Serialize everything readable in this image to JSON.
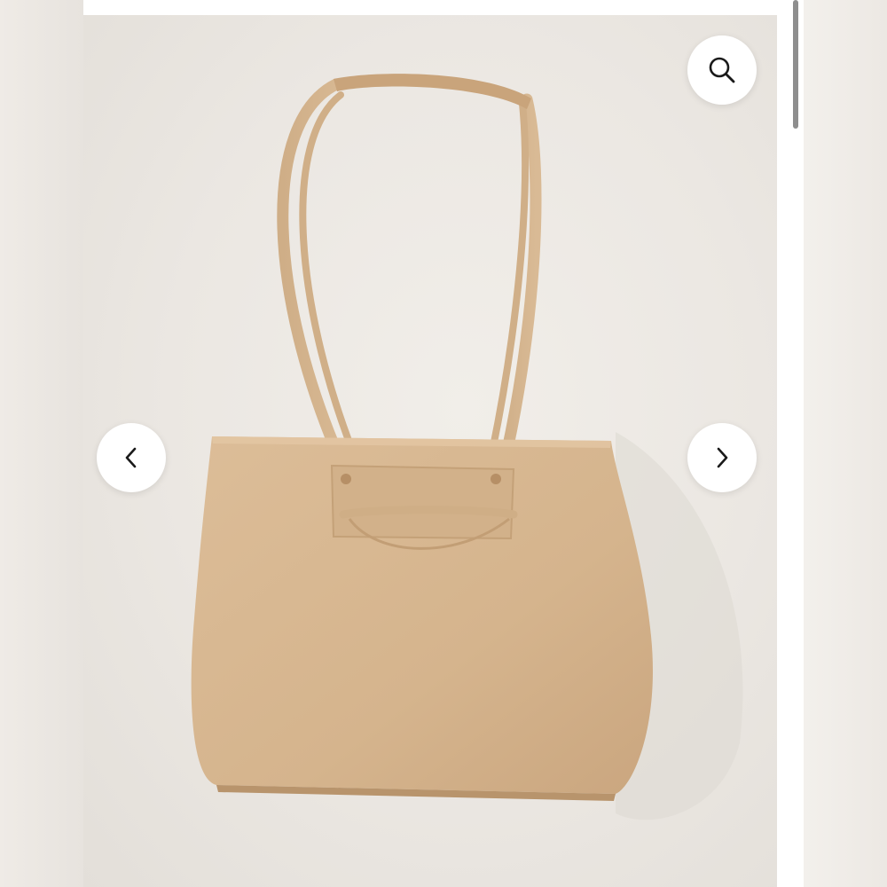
{
  "gallery": {
    "image_alt": "",
    "zoom_icon": "search-icon",
    "prev_icon": "chevron-left-icon",
    "next_icon": "chevron-right-icon"
  },
  "colors": {
    "background": "#ebe7e2",
    "bag": "#d7b792",
    "bag_shadow": "#c9a67f",
    "button_bg": "#ffffff",
    "icon": "#1a1a1a",
    "scrollbar": "#8e8e8e"
  }
}
